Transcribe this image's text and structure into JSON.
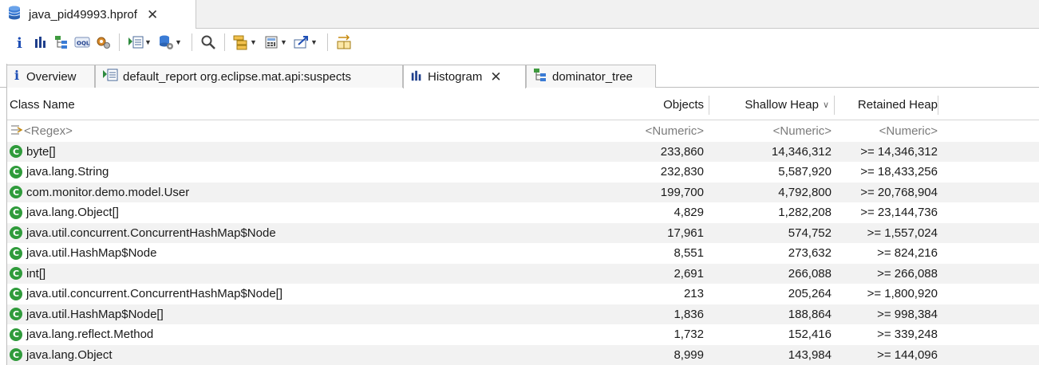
{
  "editor_tab": {
    "title": "java_pid49993.hprof",
    "close": "✕"
  },
  "toolbar": {
    "icons": [
      "info-icon",
      "histogram-icon",
      "dominator-tree-icon",
      "oql-icon",
      "threads-icon",
      "run-report-icon",
      "query-browser-icon",
      "search-icon",
      "group-by-icon",
      "calculator-icon",
      "export-icon",
      "compare-icon"
    ]
  },
  "subtabs": [
    {
      "label": "Overview",
      "icon": "info-icon",
      "active": false
    },
    {
      "label": "default_report org.eclipse.mat.api:suspects",
      "icon": "report-icon",
      "active": false
    },
    {
      "label": "Histogram",
      "icon": "histogram-icon",
      "active": true,
      "close": "✕"
    },
    {
      "label": "dominator_tree",
      "icon": "dominator-tree-icon",
      "active": false
    }
  ],
  "table": {
    "columns": {
      "class_name": "Class Name",
      "objects": "Objects",
      "shallow_heap": "Shallow Heap",
      "retained_heap": "Retained Heap"
    },
    "filter": {
      "class_name": "<Regex>",
      "objects": "<Numeric>",
      "shallow_heap": "<Numeric>",
      "retained_heap": "<Numeric>"
    },
    "rows": [
      {
        "name": "byte[]",
        "objects": "233,860",
        "shallow": "14,346,312",
        "retained": ">= 14,346,312"
      },
      {
        "name": "java.lang.String",
        "objects": "232,830",
        "shallow": "5,587,920",
        "retained": ">= 18,433,256"
      },
      {
        "name": "com.monitor.demo.model.User",
        "objects": "199,700",
        "shallow": "4,792,800",
        "retained": ">= 20,768,904"
      },
      {
        "name": "java.lang.Object[]",
        "objects": "4,829",
        "shallow": "1,282,208",
        "retained": ">= 23,144,736"
      },
      {
        "name": "java.util.concurrent.ConcurrentHashMap$Node",
        "objects": "17,961",
        "shallow": "574,752",
        "retained": ">= 1,557,024"
      },
      {
        "name": "java.util.HashMap$Node",
        "objects": "8,551",
        "shallow": "273,632",
        "retained": ">= 824,216"
      },
      {
        "name": "int[]",
        "objects": "2,691",
        "shallow": "266,088",
        "retained": ">= 266,088"
      },
      {
        "name": "java.util.concurrent.ConcurrentHashMap$Node[]",
        "objects": "213",
        "shallow": "205,264",
        "retained": ">= 1,800,920"
      },
      {
        "name": "java.util.HashMap$Node[]",
        "objects": "1,836",
        "shallow": "188,864",
        "retained": ">= 998,384"
      },
      {
        "name": "java.lang.reflect.Method",
        "objects": "1,732",
        "shallow": "152,416",
        "retained": ">= 339,248"
      },
      {
        "name": "java.lang.Object",
        "objects": "8,999",
        "shallow": "143,984",
        "retained": ">= 144,096"
      }
    ]
  },
  "colors": {
    "class_icon": "#2f9b3b",
    "alt_row": "#f2f2f2",
    "accent_blue": "#1f4fb5"
  }
}
